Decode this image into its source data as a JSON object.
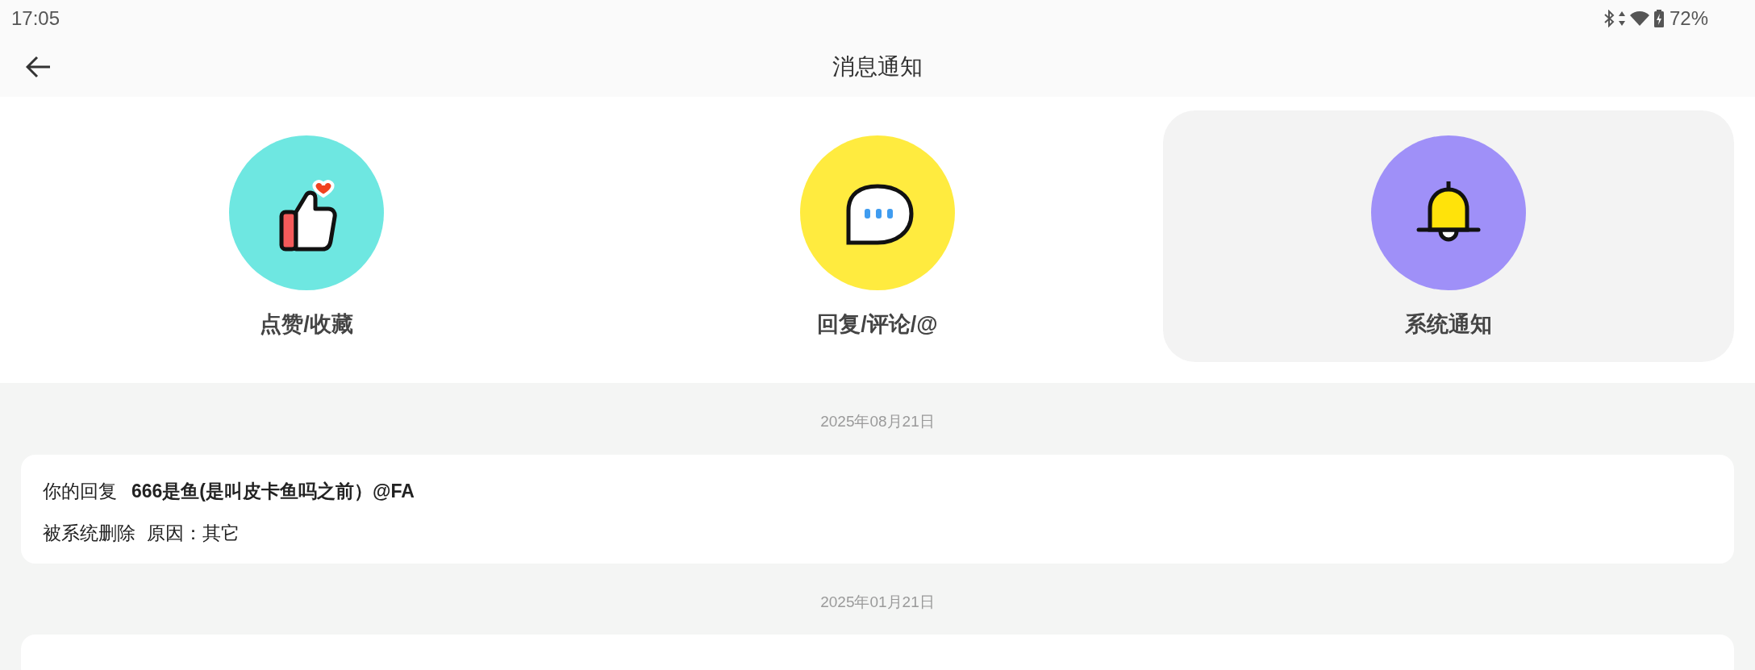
{
  "status_bar": {
    "time": "17:05",
    "battery": "72%"
  },
  "header": {
    "title": "消息通知"
  },
  "tabs": [
    {
      "kind": "like",
      "label": "点赞/收藏",
      "selected": false
    },
    {
      "kind": "comment",
      "label": "回复/评论/@",
      "selected": false
    },
    {
      "kind": "system",
      "label": "系统通知",
      "selected": true
    }
  ],
  "messages": [
    {
      "date": "2025年08月21日",
      "prefix": "你的回复",
      "subject": "666是鱼(是叫皮卡鱼吗之前）@FA",
      "action": "被系统删除",
      "reason": "原因：其它"
    },
    {
      "date": "2025年01月21日"
    }
  ]
}
